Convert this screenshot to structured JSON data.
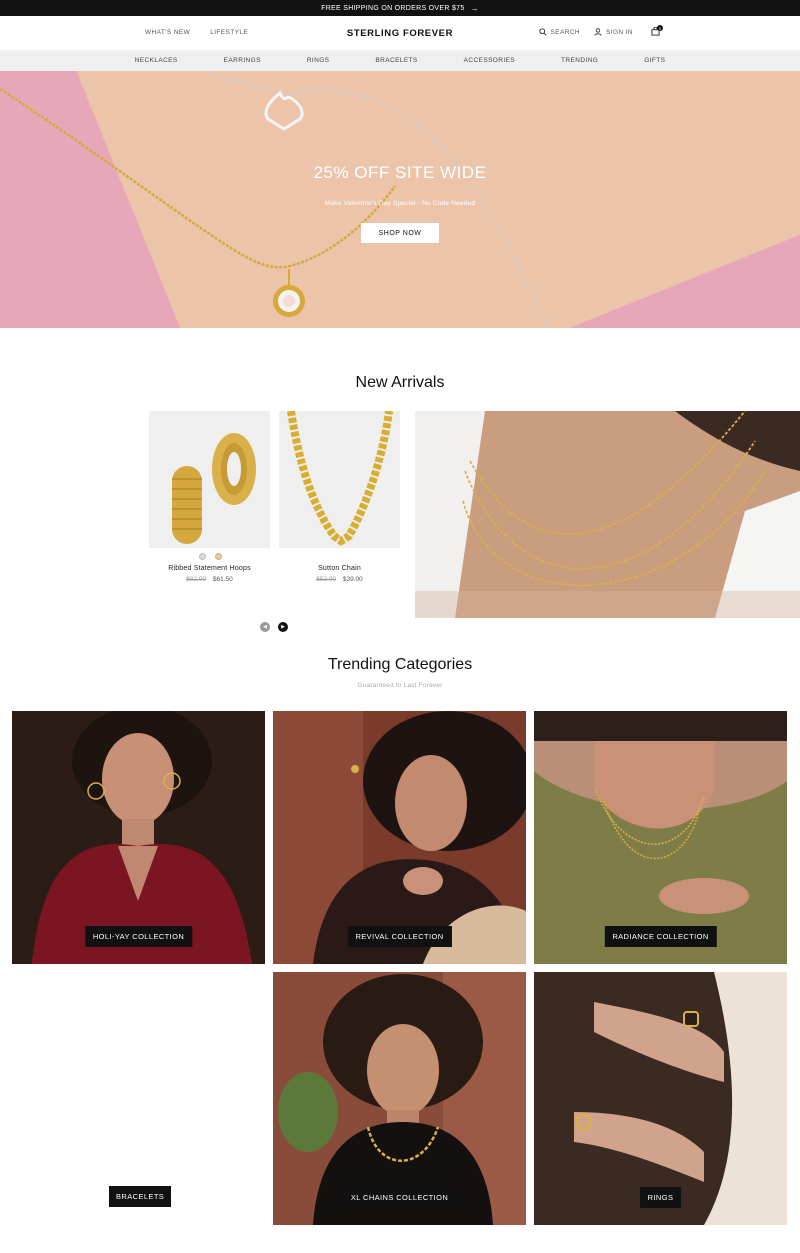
{
  "announcement": {
    "text": "FREE SHIPPING ON ORDERS OVER $75"
  },
  "header": {
    "left_links": [
      "WHAT'S NEW",
      "LIFESTYLE"
    ],
    "logo": "STERLING FOREVER",
    "search_label": "SEARCH",
    "signin_label": "SIGN IN",
    "cart_count": "0"
  },
  "nav": [
    "NECKLACES",
    "EARRINGS",
    "RINGS",
    "BRACELETS",
    "ACCESSORIES",
    "TRENDING",
    "GIFTS"
  ],
  "hero": {
    "title": "25% OFF SITE WIDE",
    "subtitle": "Make Valentine's Day Special - No Code Needed",
    "button": "SHOP NOW"
  },
  "new_arrivals": {
    "title": "New Arrivals",
    "products": [
      {
        "name": "Ribbed Statement Hoops",
        "old_price": "$82.00",
        "price": "$61.50"
      },
      {
        "name": "Sutton Chain",
        "old_price": "$52.00",
        "price": "$39.00"
      }
    ],
    "swatch_colors": [
      "#d9d9d9",
      "#e8c9a0"
    ]
  },
  "trending": {
    "title": "Trending Categories",
    "subtitle": "Guaranteed to Last Forever",
    "tiles": [
      {
        "label": "HOLI-YAY COLLECTION"
      },
      {
        "label": "REVIVAL COLLECTION"
      },
      {
        "label": "RADIANCE COLLECTION"
      },
      {
        "label": "BRACELETS"
      },
      {
        "label": "XL CHAINS COLLECTION"
      },
      {
        "label": "RINGS"
      }
    ]
  },
  "colors": {
    "announce_bg": "#121212",
    "nav_bg": "#efefef",
    "hero_pink": "#e6a8b8",
    "hero_peach": "#ecc4aa",
    "gold": "#d4a72c"
  }
}
